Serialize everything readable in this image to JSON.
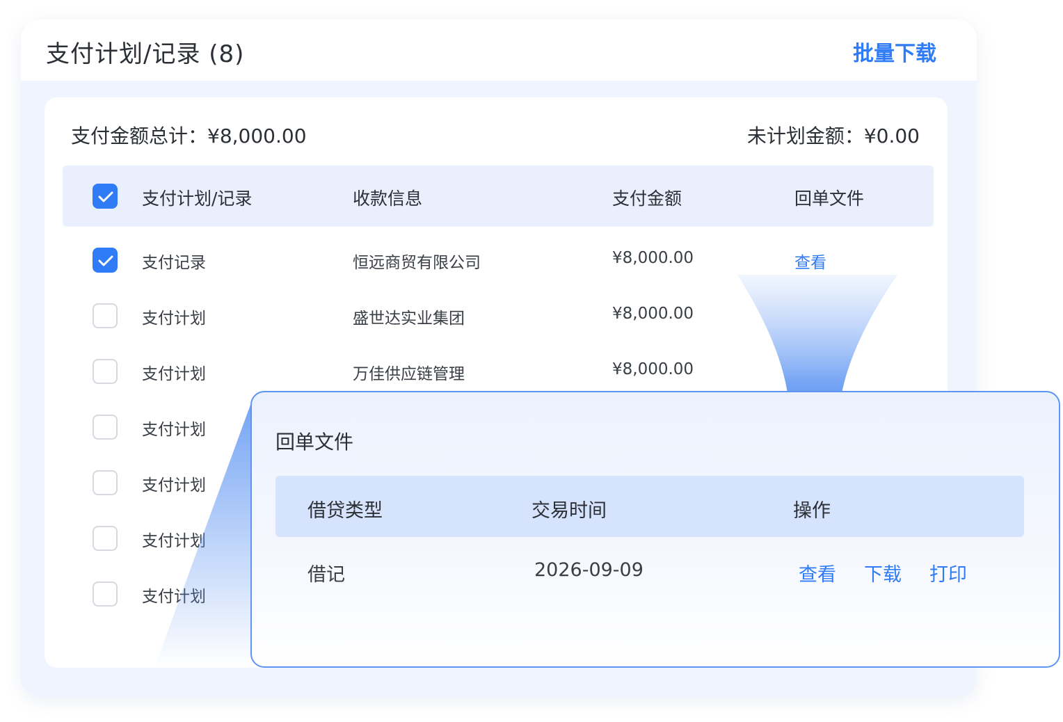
{
  "panel": {
    "title": "支付计划/记录 (8)",
    "bulk_download": "批量下载"
  },
  "summary": {
    "total": "支付金额总计：¥8,000.00",
    "unplanned": "未计划金额：¥0.00"
  },
  "table": {
    "header_checked": true,
    "columns": [
      "支付计划/记录",
      "收款信息",
      "支付金额",
      "回单文件"
    ],
    "rows": [
      {
        "checked": true,
        "type": "支付记录",
        "payee": "恒远商贸有限公司",
        "amount": "¥8,000.00",
        "receipt": "查看"
      },
      {
        "checked": false,
        "type": "支付计划",
        "payee": "盛世达实业集团",
        "amount": "¥8,000.00",
        "receipt": ""
      },
      {
        "checked": false,
        "type": "支付计划",
        "payee": "万佳供应链管理",
        "amount": "¥8,000.00",
        "receipt": ""
      },
      {
        "checked": false,
        "type": "支付计划",
        "payee": "",
        "amount": "",
        "receipt": ""
      },
      {
        "checked": false,
        "type": "支付计划",
        "payee": "",
        "amount": "",
        "receipt": ""
      },
      {
        "checked": false,
        "type": "支付计划",
        "payee": "",
        "amount": "",
        "receipt": ""
      },
      {
        "checked": false,
        "type": "支付计划",
        "payee": "",
        "amount": "",
        "receipt": ""
      }
    ]
  },
  "popup": {
    "title": "回单文件",
    "columns": [
      "借贷类型",
      "交易时间",
      "操作"
    ],
    "rows": [
      {
        "type": "借记",
        "time": "2026-09-09",
        "actions": [
          "查看",
          "下载",
          "打印"
        ]
      }
    ]
  },
  "colors": {
    "accent": "#2f7cf6",
    "header_bg": "#e9effd",
    "panel_bg": "#eff4fe"
  }
}
